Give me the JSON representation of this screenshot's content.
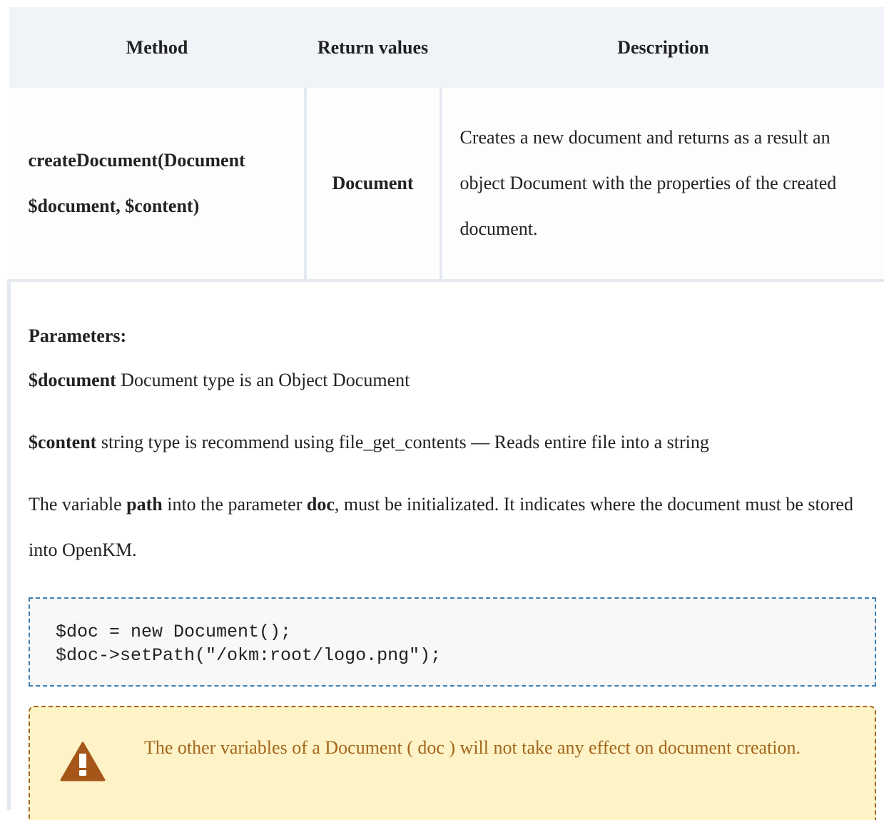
{
  "table": {
    "headers": {
      "method": "Method",
      "return_values": "Return values",
      "description": "Description"
    },
    "row": {
      "method_line1": "createDocument(Document",
      "method_line2": "$document, $content)",
      "return_value": "Document",
      "description": "Creates a new document and returns as a result an object Document with the properties of the created document."
    }
  },
  "parameters": {
    "heading": "Parameters:",
    "document_param": {
      "name": "$document",
      "text": " Document type is an Object Document"
    },
    "content_param": {
      "name": "$content",
      "text": " string type is recommend using file_get_contents — Reads entire file into a string"
    },
    "note": {
      "prefix": "The variable ",
      "var1": "path",
      "middle": " into the parameter ",
      "var2": "doc",
      "suffix": ", must be initializated. It indicates where the document must be stored into OpenKM."
    },
    "code": {
      "line1": "$doc = new Document();",
      "line2": "$doc->setPath(\"/okm:root/logo.png\");"
    },
    "warning": {
      "icon": "warning-triangle-icon",
      "text": "The other variables of a Document ( doc ) will not take any effect on document creation."
    }
  },
  "colors": {
    "header_bg": "#f0f3f7",
    "code_border": "#3d7fb6",
    "warning_bg": "#fdf3c6",
    "warning_text": "#a5661e"
  }
}
